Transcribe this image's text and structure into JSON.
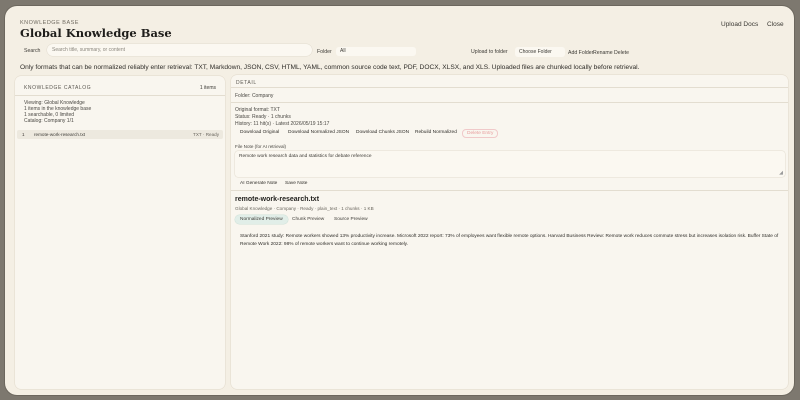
{
  "header": {
    "kicker": "KNOWLEDGE BASE",
    "title": "Global Knowledge Base",
    "upload_docs": "Upload Docs",
    "close": "Close"
  },
  "toolbar": {
    "search_label": "Search",
    "search_placeholder": "Search title, summary, or content",
    "folder_label": "Folder",
    "folder_value": "All",
    "upload_to_folder_label": "Upload to folder",
    "choose_folder": "Choose Folder",
    "add_folder": "Add Folder",
    "rename": "Rename",
    "delete": "Delete"
  },
  "info_text": "Only formats that can be normalized reliably enter retrieval: TXT, Markdown, JSON, CSV, HTML, YAML, common source code text, PDF, DOCX, XLSX, and XLS. Uploaded files are chunked locally before retrieval.",
  "catalog": {
    "heading": "KNOWLEDGE CATALOG",
    "count": "1 items",
    "viewing": "Viewing: Global Knowledge",
    "items_line": "1 items in the knowledge base",
    "searchable_line": "1 searchable, 0 limited",
    "catalog_line": "Catalog: Company 1/1",
    "items": [
      {
        "index": "1",
        "name": "remote-work-research.txt",
        "status": "TXT · Ready"
      }
    ]
  },
  "detail": {
    "heading": "DETAIL",
    "folder_line": "Folder: Company",
    "original_format": "Original format: TXT",
    "status_line": "Status: Ready · 1 chunks",
    "history_line": "History: 11 hit(s) · Latest 2026/05/19 15:17",
    "buttons": {
      "download_original": "Download Original",
      "download_normalized": "Download Normalized JSON",
      "download_chunks": "Download Chunks JSON",
      "rebuild": "Rebuild Normalized",
      "delete_entry": "Delete Entry"
    },
    "note_label": "File Note (for AI retrieval)",
    "note_value": "Remote work research data and statistics for debate reference",
    "ai_generate_note": "AI Generate Note",
    "save_note": "Save Note",
    "file_title": "remote-work-research.txt",
    "file_meta": "Global Knowledge · Company · Ready · plain_text · 1 chunks · 1 KB",
    "tabs": [
      "Normalized Preview",
      "Chunk Preview",
      "Source Preview"
    ],
    "preview_text": "Stanford 2021 study: Remote workers showed 13% productivity increase. Microsoft 2022 report: 73% of employees want flexible remote options. Harvard Business Review: Remote work reduces commute stress but increases isolation risk. Buffer State of Remote Work 2022: 98% of remote workers want to continue working remotely."
  }
}
